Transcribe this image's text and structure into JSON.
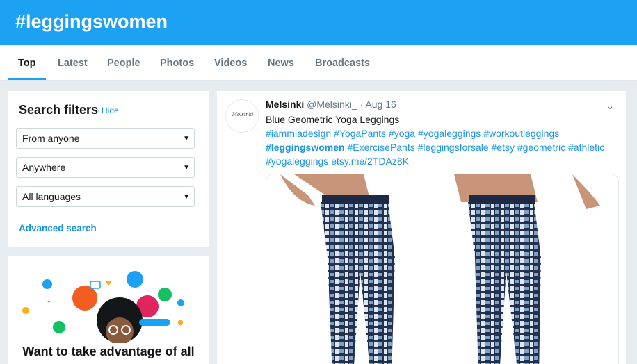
{
  "header": {
    "title": "#leggingswomen"
  },
  "tabs": [
    {
      "label": "Top",
      "active": true
    },
    {
      "label": "Latest"
    },
    {
      "label": "People"
    },
    {
      "label": "Photos"
    },
    {
      "label": "Videos"
    },
    {
      "label": "News"
    },
    {
      "label": "Broadcasts"
    }
  ],
  "filters": {
    "title": "Search filters",
    "hide_label": "Hide",
    "from_value": "From anyone",
    "location_value": "Anywhere",
    "language_value": "All languages",
    "advanced_label": "Advanced search"
  },
  "promo": {
    "heading": "Want to take advantage of all"
  },
  "tweet": {
    "avatar_text": "Melsinki",
    "author": "Melsinki",
    "handle": "@Melsinki_",
    "separator": "·",
    "date": "Aug 16",
    "title": "Blue Geometric Yoga Leggings",
    "tags": [
      "#iammiadesign",
      "#YogaPants",
      "#yoga",
      "#yogaleggings",
      "#workoutleggings",
      "#leggingswomen",
      "#ExercisePants",
      "#leggingsforsale",
      "#etsy",
      "#geometric",
      "#athletic",
      "#yogaleggings"
    ],
    "link": "etsy.me/2TDAz8K"
  },
  "colors": {
    "brand": "#1da1f2",
    "link": "#1b95e0",
    "background": "#e6ecf0"
  },
  "icons": {
    "tweet_menu": "chevron-down-icon",
    "select_caret": "caret-down-icon"
  }
}
